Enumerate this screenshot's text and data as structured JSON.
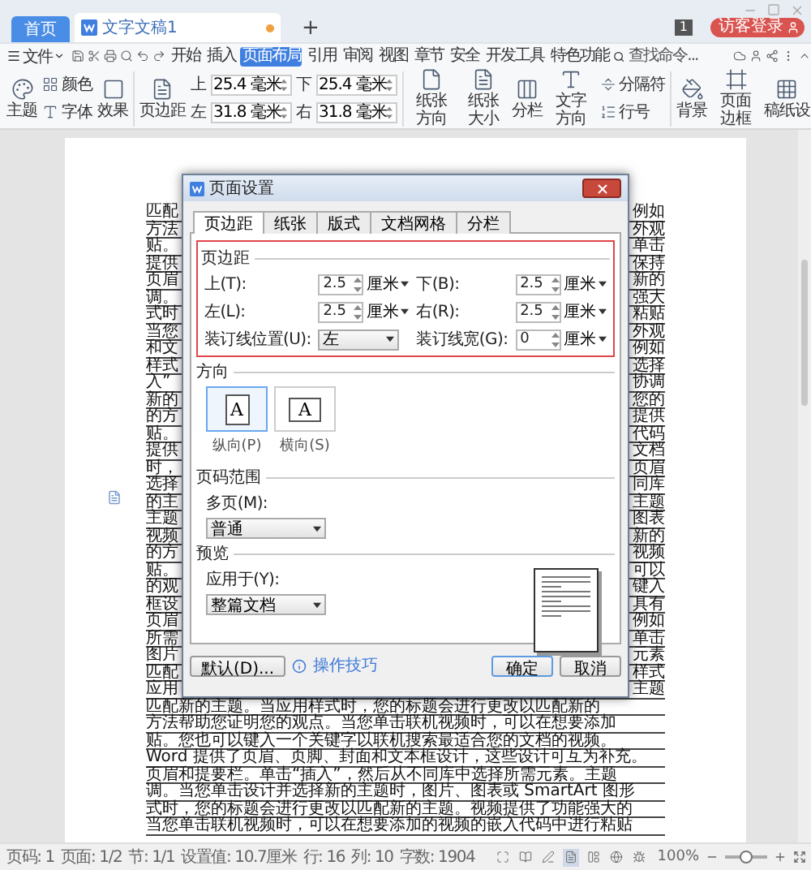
{
  "tabs": [
    {
      "label": "首页",
      "kind": "home",
      "selected": false
    },
    {
      "label": "文字文稿1",
      "kind": "doc",
      "selected": true
    }
  ],
  "new_tab": "+",
  "window_badge": "1",
  "login_button": "访客登录",
  "menu": {
    "file": "文件",
    "tabs": [
      {
        "label": "开始",
        "selected": false
      },
      {
        "label": "插入",
        "selected": false
      },
      {
        "label": "页面布局",
        "selected": true
      },
      {
        "label": "引用",
        "selected": false
      },
      {
        "label": "审阅",
        "selected": false
      },
      {
        "label": "视图",
        "selected": false
      },
      {
        "label": "章节",
        "selected": false
      },
      {
        "label": "安全",
        "selected": false
      },
      {
        "label": "开发工具",
        "selected": false
      },
      {
        "label": "特色功能",
        "selected": false
      }
    ],
    "search_placeholder": "查找命令..."
  },
  "ribbon": [
    [
      [
        {
          "kind": "big",
          "label": "主题"
        }
      ],
      [
        {
          "kind": "small",
          "label": "颜色"
        },
        {
          "kind": "small",
          "label": "字体"
        }
      ],
      [
        {
          "kind": "big",
          "label": "效果"
        }
      ]
    ],
    [
      [
        {
          "kind": "big",
          "label": "页边距"
        }
      ],
      [
        {
          "kind": "field",
          "label": "上",
          "value": "25.4 毫米"
        },
        {
          "kind": "field",
          "label": "左",
          "value": "31.8 毫米"
        }
      ],
      [
        {
          "kind": "field",
          "label": "下",
          "value": "25.4 毫米"
        },
        {
          "kind": "field",
          "label": "右",
          "value": "31.8 毫米"
        }
      ]
    ],
    [
      [
        {
          "kind": "big",
          "label": "纸张方向"
        }
      ],
      [
        {
          "kind": "big",
          "label": "纸张大小"
        }
      ],
      [
        {
          "kind": "big",
          "label": "分栏"
        }
      ],
      [
        {
          "kind": "big",
          "label": "文字方向"
        }
      ],
      [
        {
          "kind": "small",
          "label": "分隔符"
        },
        {
          "kind": "small",
          "label": "行号"
        }
      ]
    ],
    [
      [
        {
          "kind": "big",
          "label": "背景"
        }
      ],
      [
        {
          "kind": "big",
          "label": "页面边框"
        }
      ],
      [
        {
          "kind": "big",
          "label": "稿纸设"
        }
      ]
    ]
  ],
  "document": {
    "lines_beside_dialog": [
      {
        "left": "匹配",
        "right": "例如"
      },
      {
        "left": "方法",
        "right": "外观"
      },
      {
        "left": "贴。",
        "right": "单击"
      },
      {
        "left": "提供",
        "right": "保持"
      },
      {
        "left": "页眉",
        "right": "新的"
      },
      {
        "left": "调。",
        "right": "强大"
      },
      {
        "left": "式时",
        "right": "粘贴"
      },
      {
        "left": "当您",
        "right": "外观"
      },
      {
        "left": "和文",
        "right": "例如"
      },
      {
        "left": "样式",
        "right": "选择"
      },
      {
        "left": "入”",
        "right": "协调"
      },
      {
        "left": "新的",
        "right": "您的"
      },
      {
        "left": "的方",
        "right": "提供"
      },
      {
        "left": "贴。",
        "right": "代码"
      },
      {
        "left": "提供",
        "right": "文档"
      },
      {
        "left": "时，",
        "right": "页眉"
      },
      {
        "left": "选择",
        "right": "同库"
      },
      {
        "left": "的主",
        "right": "主题"
      },
      {
        "left": "主题",
        "right": "图表"
      },
      {
        "left": "视频",
        "right": "新的"
      },
      {
        "left": "的方",
        "right": "视频"
      },
      {
        "left": "贴。",
        "right": "可以"
      },
      {
        "left": "的观",
        "right": "键入"
      },
      {
        "left": "框设",
        "right": "具有"
      },
      {
        "left": "页眉",
        "right": "例如"
      },
      {
        "left": "所需",
        "right": "单击"
      },
      {
        "left": "图片",
        "right": "元素"
      },
      {
        "left": "匹配",
        "right": "样式"
      },
      {
        "left": "应用",
        "right": "主题"
      }
    ],
    "lines_below_dialog": [
      "匹配新的主题。当应用样式时，您的标题会进行更改以匹配新的",
      "方法帮助您证明您的观点。当您单击联机视频时，可以在想要添加",
      "贴。您也可以键入一个关键字以联机搜索最适合您的文档的视频。",
      "Word 提供了页眉、页脚、封面和文本框设计，这些设计可互为补充。",
      "页眉和提要栏。单击“插入”，然后从不同库中选择所需元素。主题",
      "调。当您单击设计并选择新的主题时，图片、图表或 SmartArt 图形",
      "式时，您的标题会进行更改以匹配新的主题。视频提供了功能强大的",
      "当您单击联机视频时，可以在想要添加的视频的嵌入代码中进行粘贴"
    ]
  },
  "dialog": {
    "title": "页面设置",
    "tabs": [
      {
        "label": "页边距",
        "selected": true
      },
      {
        "label": "纸张",
        "selected": false
      },
      {
        "label": "版式",
        "selected": false
      },
      {
        "label": "文档网格",
        "selected": false
      },
      {
        "label": "分栏",
        "selected": false
      }
    ],
    "margins": {
      "heading": "页边距",
      "fields": [
        {
          "label": "上(T):",
          "value": "2.5",
          "unit": "厘米"
        },
        {
          "label": "下(B):",
          "value": "2.5",
          "unit": "厘米"
        },
        {
          "label": "左(L):",
          "value": "2.5",
          "unit": "厘米"
        },
        {
          "label": "右(R):",
          "value": "2.5",
          "unit": "厘米"
        }
      ],
      "gutter_position": {
        "label": "装订线位置(U):",
        "value": "左"
      },
      "gutter_width": {
        "label": "装订线宽(G):",
        "value": "0",
        "unit": "厘米"
      }
    },
    "orientation": {
      "heading": "方向",
      "options": [
        {
          "label": "纵向(P)",
          "glyph": "A",
          "selected": true
        },
        {
          "label": "横向(S)",
          "glyph": "A",
          "selected": false
        }
      ]
    },
    "page_range": {
      "heading": "页码范围",
      "label": "多页(M):",
      "value": "普通"
    },
    "preview": {
      "heading": "预览",
      "label": "应用于(Y):",
      "value": "整篇文档"
    },
    "buttons": {
      "default": "默认(D)...",
      "tips": "操作技巧",
      "ok": "确定",
      "cancel": "取消"
    }
  },
  "status_bar": {
    "items": [
      "页码: 1",
      "页面: 1/2",
      "节: 1/1",
      "设置值: 10.7厘米",
      "行: 16",
      "列: 10",
      "字数: 1904"
    ],
    "view_modes": [
      {
        "selected": false
      },
      {
        "selected": false
      },
      {
        "selected": false
      },
      {
        "selected": true
      },
      {
        "selected": false
      },
      {
        "selected": false
      },
      {
        "selected": false
      }
    ],
    "zoom": "100%",
    "zoom_level": {
      "level": 0.5
    }
  }
}
